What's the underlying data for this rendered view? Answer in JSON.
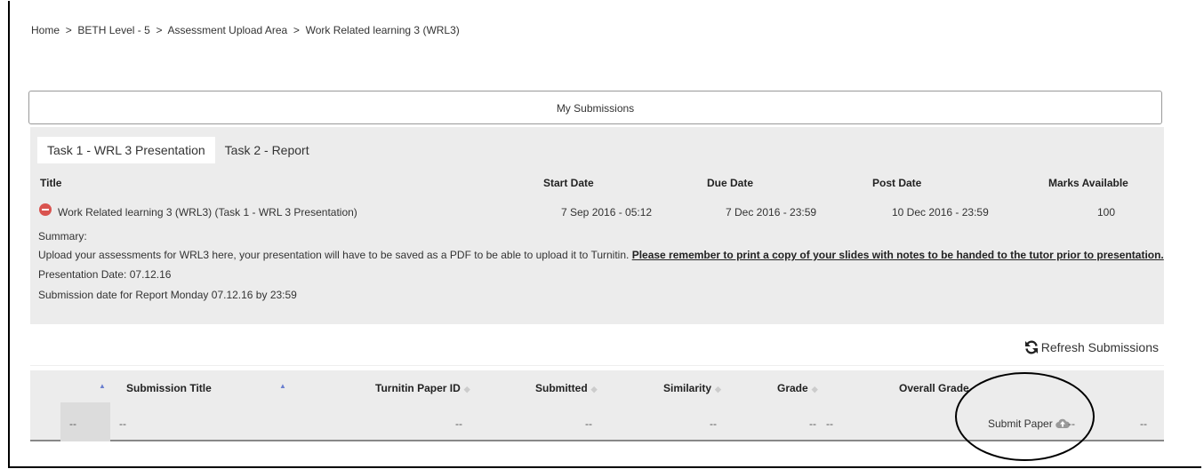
{
  "breadcrumb": [
    "Home",
    "BETH Level - 5",
    "Assessment Upload Area",
    "Work Related learning 3 (WRL3)"
  ],
  "breadcrumb_separator": ">",
  "my_submissions_label": "My Submissions",
  "tabs": [
    {
      "label": "Task 1 - WRL 3 Presentation",
      "active": true
    },
    {
      "label": "Task 2 - Report",
      "active": false
    }
  ],
  "task_table": {
    "headers": {
      "title": "Title",
      "start": "Start Date",
      "due": "Due Date",
      "post": "Post Date",
      "marks": "Marks Available"
    },
    "row": {
      "title": "Work Related learning 3 (WRL3) (Task 1 - WRL 3 Presentation)",
      "start": "7 Sep 2016 - 05:12",
      "due": "7 Dec 2016 - 23:59",
      "post": "10 Dec 2016 - 23:59",
      "marks": "100"
    }
  },
  "summary": {
    "label": "Summary:",
    "line1_plain": "Upload your assessments for WRL3 here, your presentation will have to be saved as a PDF to be able to upload it to Turnitin. ",
    "line1_bold": "Please remember to print a copy of your slides with notes to be handed to the tutor prior to presentation.",
    "line2": "Presentation Date: 07.12.16",
    "line3": "Submission date for Report Monday 07.12.16 by 23:59"
  },
  "refresh_label": "Refresh Submissions",
  "submissions_table": {
    "headers": {
      "title": "Submission Title",
      "paper_id": "Turnitin Paper ID",
      "submitted": "Submitted",
      "similarity": "Similarity",
      "grade": "Grade",
      "overall": "Overall Grade"
    },
    "row": {
      "c1": "--",
      "title": "--",
      "paper_id": "--",
      "submitted": "--",
      "similarity": "--",
      "grade": "--",
      "grade2": "--",
      "submit_label": "Submit Paper",
      "after_submit": "--",
      "last": "--"
    }
  },
  "colors": {
    "stop": "#d9534f",
    "sort_active": "#6a7fcf",
    "panel_bg": "#ececec"
  }
}
